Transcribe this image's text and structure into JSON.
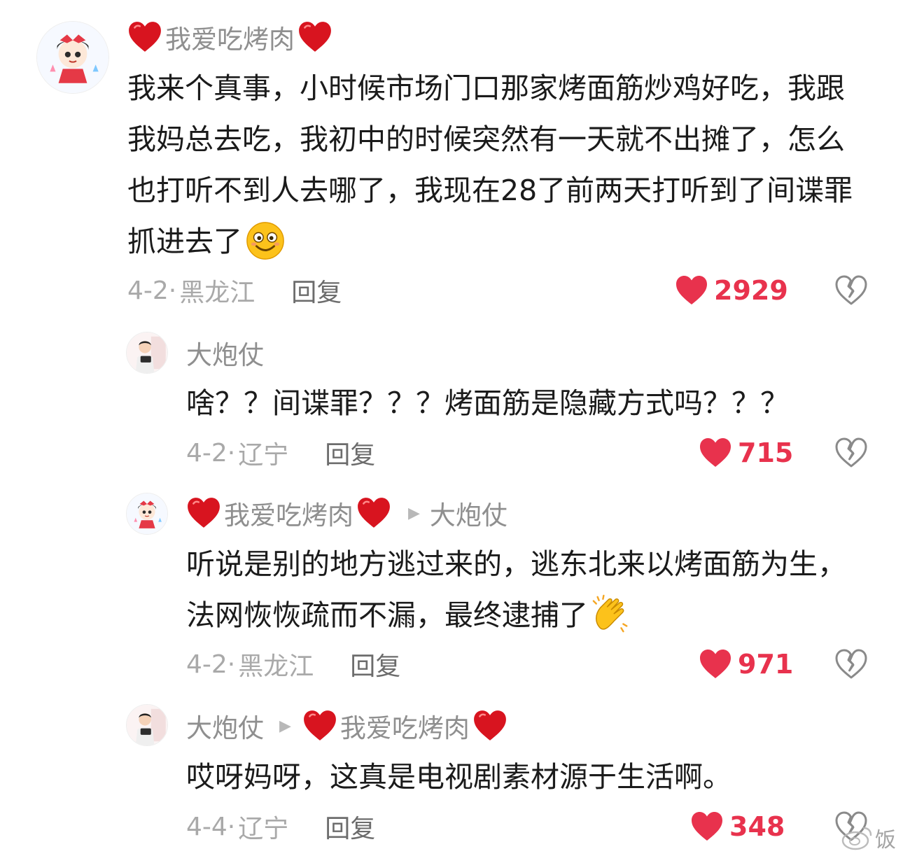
{
  "comments": [
    {
      "user": "我爱吃烤肉",
      "text": "我来个真事，小时候市场门口那家烤面筋炒鸡好吃，我跟我妈总去吃，我初中的时候突然有一天就不出摊了，怎么也打听不到人去哪了，我现在28了前两天打听到了间谍罪抓进去了",
      "date": "4-2·",
      "location": "黑龙江",
      "reply": "回复",
      "likes": "2929"
    },
    {
      "user": "大炮仗",
      "text": "啥？？间谍罪？？？烤面筋是隐藏方式吗？？？",
      "date": "4-2·",
      "location": "辽宁",
      "reply": "回复",
      "likes": "715"
    },
    {
      "user": "我爱吃烤肉",
      "reply_to": "大炮仗",
      "text": "听说是别的地方逃过来的，逃东北来以烤面筋为生，法网恢恢疏而不漏，最终逮捕了",
      "date": "4-2·",
      "location": "黑龙江",
      "reply": "回复",
      "likes": "971"
    },
    {
      "user": "大炮仗",
      "reply_to": "我爱吃烤肉",
      "text": "哎呀妈呀，这真是电视剧素材源于生活啊。",
      "date": "4-4·",
      "location": "辽宁",
      "reply": "回复",
      "likes": "348"
    }
  ],
  "watermark": "饭",
  "colors": {
    "like": "#e8324d",
    "heart_emoji": "#d8141f",
    "meta": "#a9a9a9",
    "username": "#8f8f8f"
  },
  "icons": [
    "heart-icon",
    "broken-heart-icon",
    "smile-emoji",
    "clap-emoji",
    "play-arrow-icon"
  ]
}
